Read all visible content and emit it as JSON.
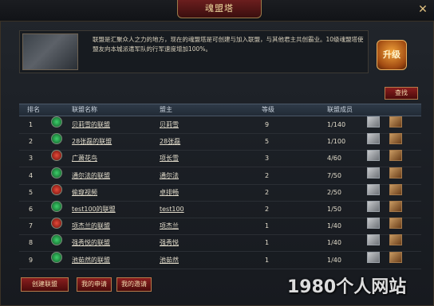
{
  "window": {
    "title": "魂盟塔",
    "close_symbol": "✕"
  },
  "info": {
    "description": "联盟是汇聚众人之力的地方，现在的魂盟塔是可创建与加入联盟，与其他君主共创霸业。10级魂盟塔使盟友向本城派遣军队的行军速度增加100%。",
    "upgrade_label": "升级"
  },
  "find_label": "查找",
  "table": {
    "headers": [
      "排名",
      "联盟名称",
      "盟主",
      "等级",
      "联盟成员"
    ],
    "rows": [
      {
        "rank": "1",
        "name": "贝莉雪的联盟",
        "leader": "贝莉雪",
        "level": "9",
        "members": "1/140",
        "emblem": "g"
      },
      {
        "rank": "2",
        "name": "28张磊的联盟",
        "leader": "28张磊",
        "level": "5",
        "members": "1/100",
        "emblem": "g"
      },
      {
        "rank": "3",
        "name": "广萧花鸟",
        "leader": "项长雪",
        "level": "3",
        "members": "4/60",
        "emblem": "r"
      },
      {
        "rank": "4",
        "name": "通尔法的联盟",
        "leader": "通尔法",
        "level": "2",
        "members": "7/50",
        "emblem": "g"
      },
      {
        "rank": "5",
        "name": "偷窥视频",
        "leader": "卓排畅",
        "level": "2",
        "members": "2/50",
        "emblem": "r"
      },
      {
        "rank": "6",
        "name": "test100的联盟",
        "leader": "test100",
        "level": "2",
        "members": "1/50",
        "emblem": "g"
      },
      {
        "rank": "7",
        "name": "项杰兰的联盟",
        "leader": "项杰兰",
        "level": "1",
        "members": "1/40",
        "emblem": "r"
      },
      {
        "rank": "8",
        "name": "强秀悦的联盟",
        "leader": "强秀悦",
        "level": "1",
        "members": "1/40",
        "emblem": "g"
      },
      {
        "rank": "9",
        "name": "池茹然的联盟",
        "leader": "池茹然",
        "level": "1",
        "members": "1/40",
        "emblem": "g"
      }
    ]
  },
  "bottom": {
    "create_label": "创建联盟",
    "my_apply_label": "我的申请",
    "my_invite_label": "我的邀请"
  },
  "watermark": "1980个人网站"
}
